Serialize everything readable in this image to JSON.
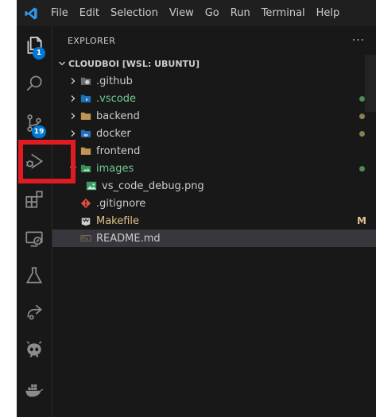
{
  "menu": [
    "File",
    "Edit",
    "Selection",
    "View",
    "Go",
    "Run",
    "Terminal",
    "Help"
  ],
  "activity_bar": {
    "explorer_badge": "1",
    "source_control_badge": "19",
    "items": [
      "explorer",
      "search",
      "source-control",
      "run-and-debug",
      "extensions",
      "remote-explorer",
      "testing",
      "live-share",
      "github-copilot",
      "docker"
    ]
  },
  "sidebar": {
    "title": "EXPLORER",
    "more_actions": "···",
    "workspace": "CLOUDBOI [WSL: UBUNTU]",
    "tree": [
      {
        "label": ".github",
        "type": "folder",
        "expanded": false,
        "color": "#cccccc",
        "status": ""
      },
      {
        "label": ".vscode",
        "type": "folder",
        "expanded": false,
        "color": "#73c991",
        "status": "dot-green"
      },
      {
        "label": "backend",
        "type": "folder",
        "expanded": false,
        "color": "#cccccc",
        "status": "dot-olive"
      },
      {
        "label": "docker",
        "type": "folder",
        "expanded": false,
        "color": "#cccccc",
        "status": "dot-olive"
      },
      {
        "label": "frontend",
        "type": "folder",
        "expanded": false,
        "color": "#cccccc",
        "status": ""
      },
      {
        "label": "images",
        "type": "folder",
        "expanded": true,
        "color": "#73c991",
        "status": "dot-green"
      },
      {
        "label": "vs_code_debug.png",
        "type": "file",
        "color": "#cccccc",
        "status": ""
      },
      {
        "label": ".gitignore",
        "type": "file",
        "color": "#cccccc",
        "status": ""
      },
      {
        "label": "Makefile",
        "type": "file",
        "color": "#e2c08d",
        "status": "M"
      },
      {
        "label": "README.md",
        "type": "file",
        "color": "#cccccc",
        "status": "",
        "selected": true
      }
    ]
  },
  "colors": {
    "accent": "#0078d4",
    "highlight_box": "#e11b22",
    "modified": "#e2c08d",
    "untracked": "#73c991",
    "dot_olive": "#8a7f54",
    "dot_green": "#4e8a52"
  }
}
